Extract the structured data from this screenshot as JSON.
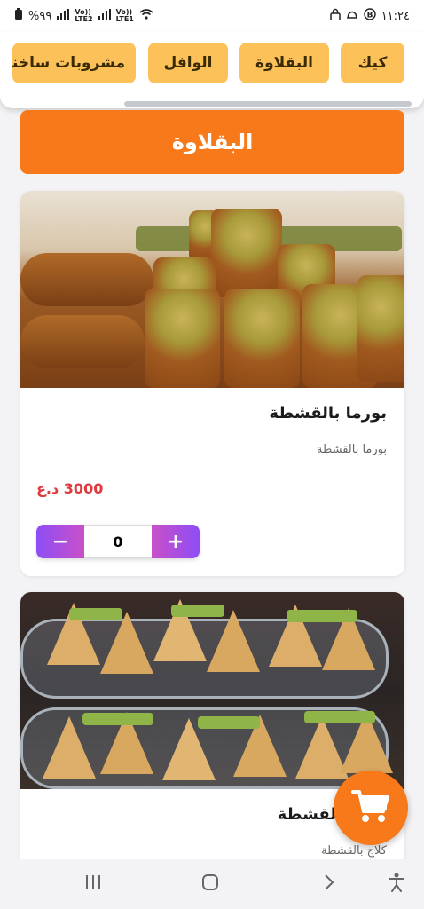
{
  "status_bar": {
    "time": "١١:٢٤",
    "battery": "%٩٩",
    "sim1_label": "Vo))\nLTE2",
    "sim2_label": "Vo))\nLTE1"
  },
  "categories": [
    {
      "label": "كيك"
    },
    {
      "label": "البقلاوة"
    },
    {
      "label": "الوافل"
    },
    {
      "label": "مشروبات ساخنة"
    }
  ],
  "section": {
    "title": "البقلاوة"
  },
  "products": [
    {
      "name": "بورما بالقشطة",
      "description": "بورما بالقشطة",
      "price": "3000 د.ع",
      "quantity": "0",
      "image": "burma-pastry"
    },
    {
      "name": "كلاج بالقشطة",
      "description": "كلاج بالقشطة",
      "image": "klaj-pastry"
    }
  ],
  "stepper": {
    "minus": "−",
    "plus": "+"
  },
  "colors": {
    "accent": "#f7791a",
    "pill": "#fcc158",
    "price": "#e0393e",
    "stepper_start": "#8e4df5",
    "stepper_end": "#c950c8"
  },
  "icons": {
    "cart": "cart-icon",
    "accessibility": "accessibility-icon"
  }
}
